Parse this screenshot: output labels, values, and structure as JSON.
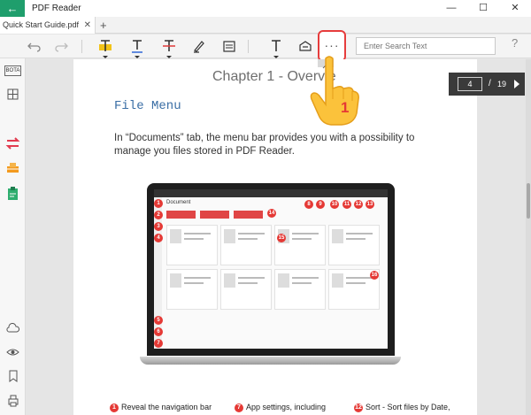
{
  "window": {
    "back_icon": "←",
    "title": "PDF Reader",
    "minimize": "—",
    "maximize": "☐",
    "close": "✕"
  },
  "tabs": [
    {
      "label": "Quick Start Guide.pdf",
      "close": "✕"
    }
  ],
  "tab_add": "+",
  "toolbar": {
    "more_label": "···",
    "search_placeholder": "Enter Search Text",
    "help": "?"
  },
  "sidebar": {
    "bota": "BOTA"
  },
  "document": {
    "chapter": "Chapter 1 - Overvie",
    "heading": "File Menu",
    "paragraph": "In “Documents” tab, the menu bar provides you with a possibility to manage you files stored in PDF Reader.",
    "screenshot": {
      "doc_label": "Document",
      "callouts": [
        "1",
        "2",
        "3",
        "4",
        "5",
        "6",
        "7",
        "8",
        "9",
        "10",
        "11",
        "12",
        "13",
        "14",
        "15",
        "16"
      ]
    },
    "bottom_items": [
      {
        "num": "1",
        "text": "Reveal the navigation bar"
      },
      {
        "num": "7",
        "text": "App settings, including"
      },
      {
        "num": "12",
        "text": "Sort - Sort files by Date,"
      }
    ]
  },
  "page_indicator": {
    "current": "4",
    "separator": "/",
    "total": "19"
  },
  "annotation": {
    "step": "1"
  },
  "colors": {
    "accent": "#1f9e6c",
    "highlight": "#e63c3c",
    "callout": "#e53935"
  }
}
